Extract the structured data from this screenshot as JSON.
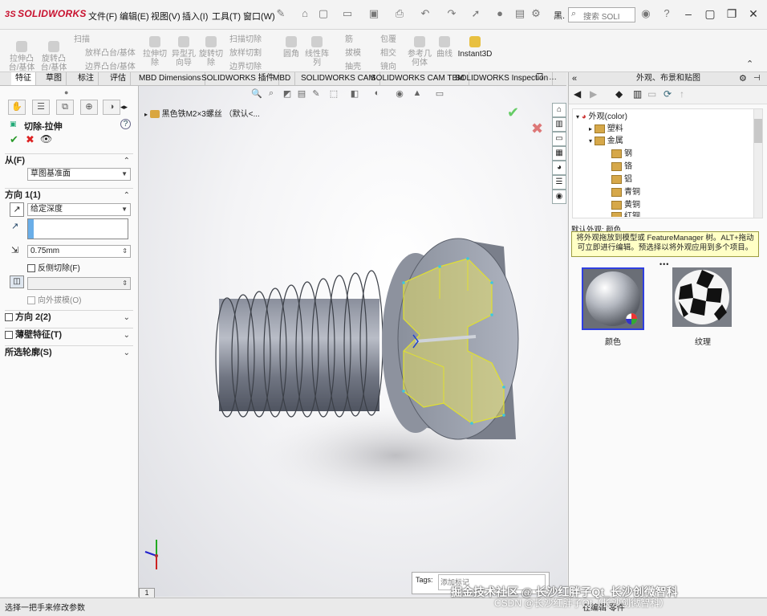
{
  "app": {
    "logo": "SOLIDWORKS",
    "logo_ds": "3S"
  },
  "menu": [
    {
      "label": "文件(F)"
    },
    {
      "label": "编辑(E)"
    },
    {
      "label": "视图(V)"
    },
    {
      "label": "插入(I)"
    },
    {
      "label": "工具(T)"
    },
    {
      "label": "窗口(W)"
    }
  ],
  "search": {
    "placeholder": "搜索 SOLI"
  },
  "toolbar_text": "黑.",
  "command_manager": {
    "groups": [
      {
        "big1": "拉伸凸\n台/基体",
        "big2": "旋转凸\n台/基体",
        "small": [
          "扫描",
          "放样凸台/基体",
          "边界凸台/基体"
        ]
      },
      {
        "big1": "拉伸切\n除",
        "big2": "异型孔\n向导",
        "big3": "旋转切\n除",
        "small": [
          "扫描切除",
          "放样切割",
          "边界切除"
        ]
      },
      {
        "big1": "圆角",
        "big2": "线性阵\n列",
        "small": [
          "筋",
          "拔模",
          "抽壳"
        ],
        "small2": [
          "包覆",
          "相交",
          "镜向"
        ]
      },
      {
        "big1": "参考几\n何体",
        "big2": "曲线",
        "big3": "Instant3D"
      }
    ]
  },
  "tabs": [
    "特征",
    "草图",
    "标注",
    "评估",
    "MBD Dimensions",
    "SOLIDWORKS 插件",
    "MBD",
    "SOLIDWORKS CAM",
    "SOLIDWORKS CAM TBM",
    "SOLIDWORKS Inspection"
  ],
  "property_manager": {
    "title": "切除-拉伸",
    "from_label": "从(F)",
    "from_value": "草图基准面",
    "dir1_label": "方向 1(1)",
    "dir1_type": "给定深度",
    "depth_value": "0.75mm",
    "reverse_label": "反侧切除(F)",
    "draft_label": "向外拔模(O)",
    "dir2_label": "方向 2(2)",
    "thin_label": "薄壁特征(T)",
    "contours_label": "所选轮廓(S)"
  },
  "graphics": {
    "breadcrumb": "黑色铁M2×3螺丝 （默认<..."
  },
  "task_pane": {
    "title": "外观、布景和贴图",
    "tree": [
      {
        "label": "外观(color)",
        "level": 0
      },
      {
        "label": "塑料",
        "level": 1
      },
      {
        "label": "金属",
        "level": 1
      },
      {
        "label": "钢",
        "level": 2
      },
      {
        "label": "铬",
        "level": 2
      },
      {
        "label": "铝",
        "level": 2
      },
      {
        "label": "青铜",
        "level": 2
      },
      {
        "label": "黄铜",
        "level": 2
      },
      {
        "label": "红铜",
        "level": 2
      }
    ],
    "hint_label": "默认外观: 颜色",
    "hint_text": "将外观拖放到模型或 FeatureManager 树。ALT+拖动可立即进行编辑。预选择以将外观应用到多个项目。",
    "thumbs": [
      {
        "label": "颜色"
      },
      {
        "label": "纹理"
      }
    ]
  },
  "tags": {
    "label": "Tags:",
    "placeholder": "添加标记"
  },
  "status": {
    "text": "选择一把手来修改参数",
    "right": "在编辑 零件",
    "watermark": "掘金技术社区 @ 长沙红胖子Qt_长沙创微智科",
    "watermark2": "CSDN @长沙红胖子Qt（长沙创微智科）"
  },
  "colors": {
    "accent": "#c8102e",
    "part": "#9aa0ad",
    "sketch": "#e8e060",
    "selection_blue": "#2244cc"
  }
}
